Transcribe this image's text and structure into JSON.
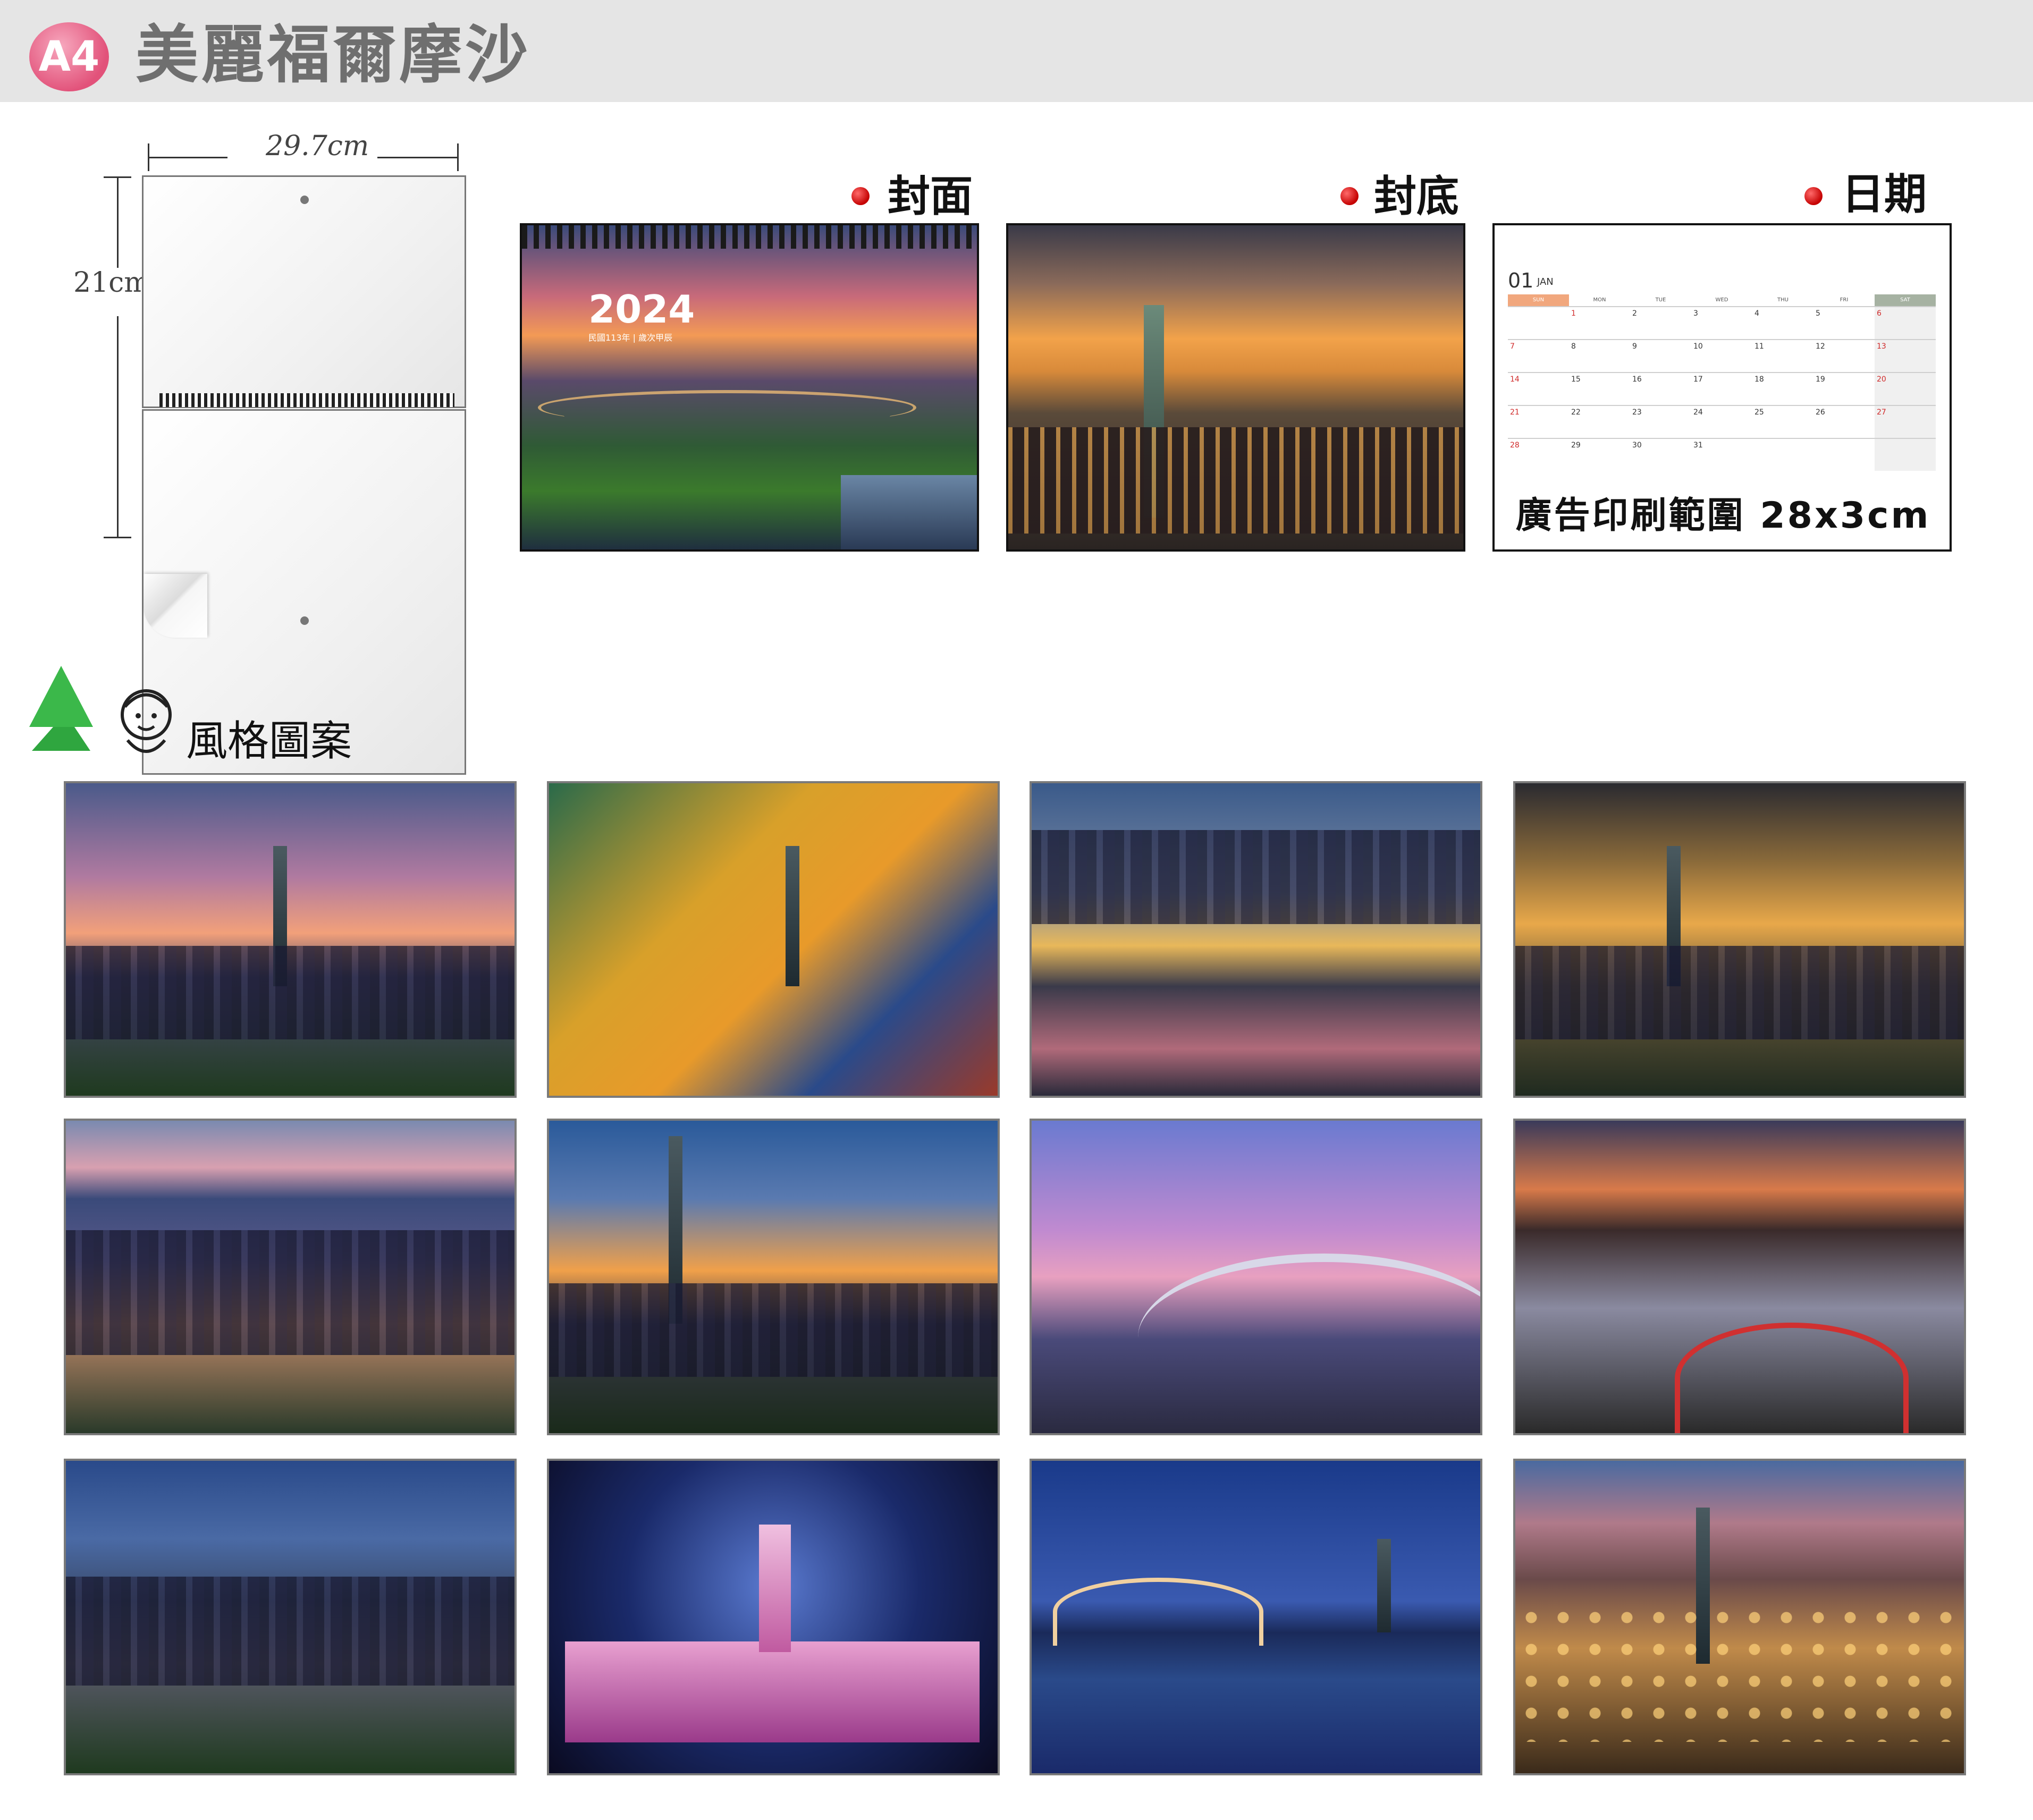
{
  "header": {
    "badge": "A4",
    "title": "美麗福爾摩沙"
  },
  "diagram": {
    "width_label": "29.7cm",
    "height_label": "21cm"
  },
  "previews": {
    "cover": {
      "label": "封面",
      "year": "2024",
      "subtitle": "民國113年 | 歲次甲辰"
    },
    "back": {
      "label": "封底"
    },
    "dates": {
      "label": "日期",
      "month_number": "01",
      "month_name": "JAN",
      "weekdays": [
        "SUN",
        "MON",
        "TUE",
        "WED",
        "THU",
        "FRI",
        "SAT"
      ],
      "weeks": [
        [
          "",
          "1",
          "2",
          "3",
          "4",
          "5",
          "6"
        ],
        [
          "7",
          "8",
          "9",
          "10",
          "11",
          "12",
          "13"
        ],
        [
          "14",
          "15",
          "16",
          "17",
          "18",
          "19",
          "20"
        ],
        [
          "21",
          "22",
          "23",
          "24",
          "25",
          "26",
          "27"
        ],
        [
          "28",
          "29",
          "30",
          "31",
          "",
          "",
          ""
        ]
      ],
      "ad_text": "廣告印刷範圍 28x3cm"
    }
  },
  "styles": {
    "title": "風格圖案"
  },
  "colors": {
    "header_bg": "#e5e5e5",
    "badge": "#e2527a",
    "title_text": "#6f6f6f",
    "dot_red": "#c40000"
  }
}
